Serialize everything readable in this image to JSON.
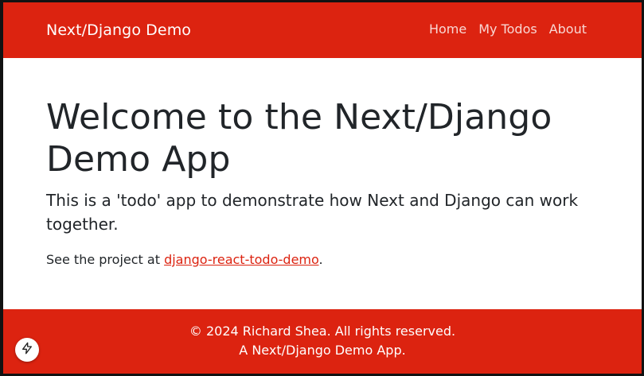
{
  "theme": {
    "brand_color": "#dc2310",
    "text_color": "#212529",
    "background": "#ffffff"
  },
  "header": {
    "brand": "Next/Django Demo",
    "nav": [
      {
        "label": "Home"
      },
      {
        "label": "My Todos"
      },
      {
        "label": "About"
      }
    ]
  },
  "main": {
    "title": "Welcome to the Next/Django Demo App",
    "lead": "This is a 'todo' app to demonstrate how Next and Django can work together.",
    "project_prefix": "See the project at ",
    "project_link": "django-react-todo-demo",
    "project_suffix": "."
  },
  "footer": {
    "line1": "© 2024 Richard Shea. All rights reserved.",
    "line2": "A Next/Django Demo App."
  },
  "floating_badge": {
    "icon": "lightning-icon"
  }
}
